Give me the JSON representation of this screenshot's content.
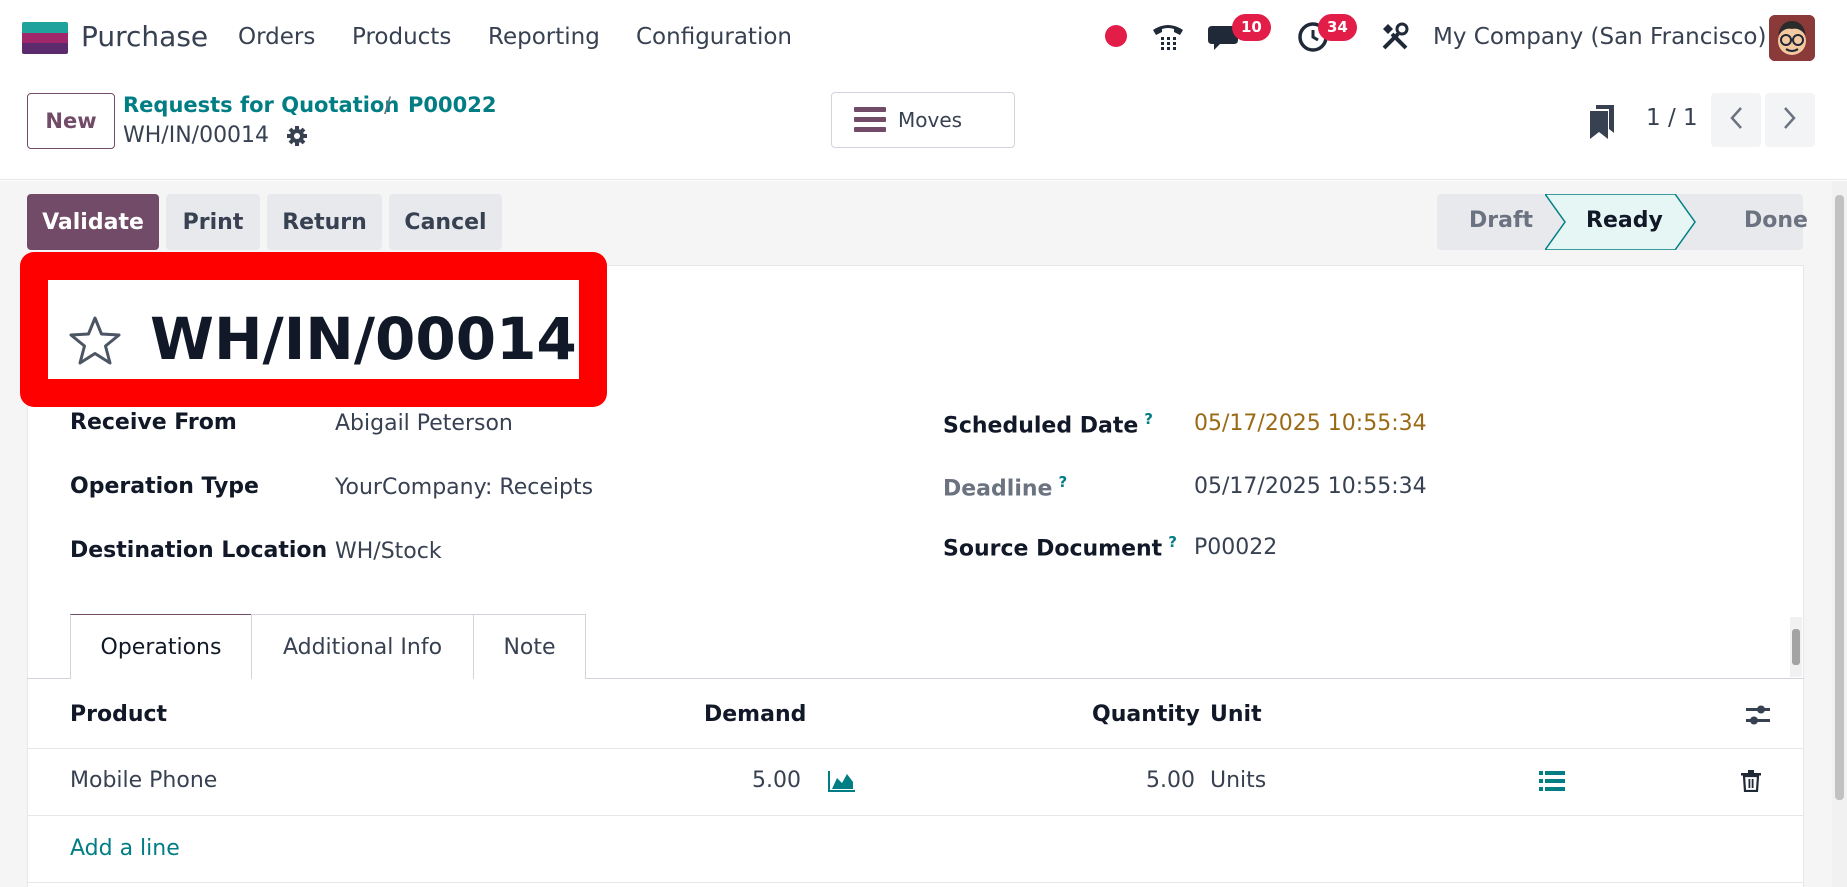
{
  "navbar": {
    "app_name": "Purchase",
    "menu": [
      "Orders",
      "Products",
      "Reporting",
      "Configuration"
    ],
    "chat_badge": "10",
    "activity_badge": "34",
    "company": "My Company (San Francisco)"
  },
  "control": {
    "new_label": "New",
    "breadcrumb_parent": "Requests for Quotation",
    "breadcrumb_separator": "/",
    "breadcrumb_order": "P00022",
    "breadcrumb_current": "WH/IN/00014",
    "moves_label": "Moves",
    "pager": "1 / 1"
  },
  "actions": {
    "validate": "Validate",
    "print": "Print",
    "return": "Return",
    "cancel": "Cancel"
  },
  "status": {
    "steps": [
      "Draft",
      "Ready",
      "Done"
    ],
    "current": "Ready"
  },
  "record": {
    "title": "WH/IN/00014",
    "receive_from_label": "Receive From",
    "receive_from": "Abigail Peterson",
    "operation_type_label": "Operation Type",
    "operation_type": "YourCompany: Receipts",
    "destination_label": "Destination Location",
    "destination": "WH/Stock",
    "scheduled_date_label": "Scheduled Date",
    "scheduled_date": "05/17/2025 10:55:34",
    "deadline_label": "Deadline",
    "deadline": "05/17/2025 10:55:34",
    "source_document_label": "Source Document",
    "source_document": "P00022",
    "help_mark": "?"
  },
  "tabs": [
    "Operations",
    "Additional Info",
    "Note"
  ],
  "table": {
    "headers": [
      "Product",
      "Demand",
      "Quantity",
      "Unit"
    ],
    "rows": [
      {
        "product": "Mobile Phone",
        "demand": "5.00",
        "quantity": "5.00",
        "unit": "Units"
      }
    ],
    "add_line": "Add a line"
  },
  "colors": {
    "primary": "#714b67",
    "link": "#017e84",
    "highlight": "#ff0000",
    "badge": "#e11d48",
    "scheduled_date": "#9a6b16"
  },
  "icons": [
    "app-logo-icon",
    "record-dot-icon",
    "phone-icon",
    "chat-icon",
    "clock-icon",
    "tools-icon",
    "gear-icon",
    "hamburger-icon",
    "bookmark-icon",
    "chevron-left-icon",
    "chevron-right-icon",
    "star-icon",
    "forecast-chart-icon",
    "list-detail-icon",
    "trash-icon",
    "column-settings-icon"
  ]
}
